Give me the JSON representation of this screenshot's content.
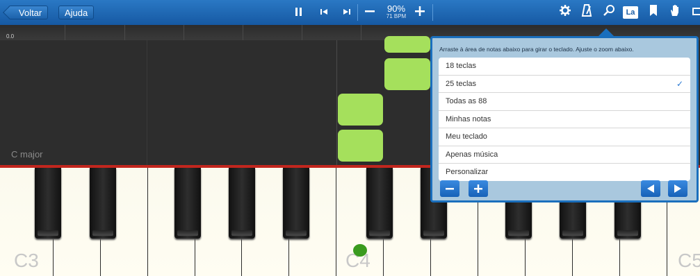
{
  "toolbar": {
    "back_label": "Voltar",
    "help_label": "Ajuda",
    "tempo_percent": "90%",
    "tempo_bpm": "71 BPM",
    "la_label": "La",
    "icons": [
      "pause-icon",
      "skip-back-icon",
      "skip-forward-icon",
      "minus-icon",
      "plus-icon",
      "gear-icon",
      "metronome-icon",
      "zoom-icon",
      "la-icon",
      "bookmark-icon",
      "hand-icon"
    ]
  },
  "timeline": {
    "start_label": "0.0"
  },
  "notes_area": {
    "key_label": "C major"
  },
  "keyboard": {
    "octave_labels": [
      "C3",
      "C4",
      "C5"
    ]
  },
  "zoom_popover": {
    "hint": "Arraste à área de notas abaixo para girar o teclado.  Ajuste o zoom abaixo.",
    "options": [
      {
        "label": "18 teclas",
        "selected": false
      },
      {
        "label": "25 teclas",
        "selected": true
      },
      {
        "label": "Todas as 88",
        "selected": false
      },
      {
        "label": "Minhas notas",
        "selected": false
      },
      {
        "label": "Meu teclado",
        "selected": false
      },
      {
        "label": "Apenas música",
        "selected": false
      },
      {
        "label": "Personalizar",
        "selected": false
      }
    ],
    "check_mark": "✓"
  },
  "colors": {
    "toolbar": "#1f6ab8",
    "note": "#a5e05c",
    "accent": "#2c7ad3",
    "playhead": "#c2261e"
  }
}
